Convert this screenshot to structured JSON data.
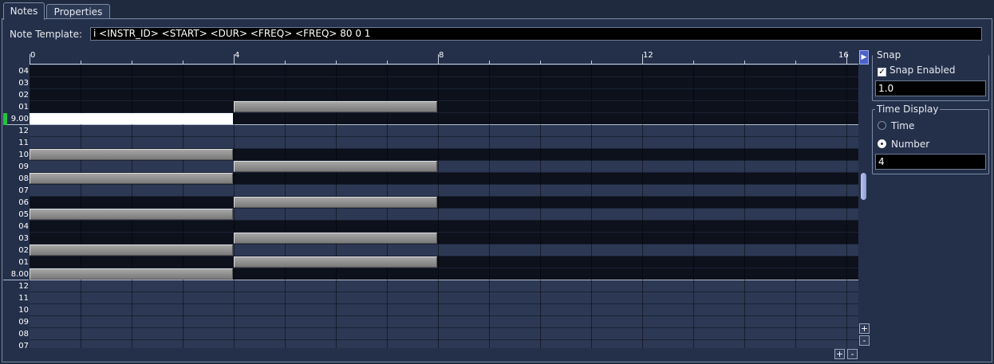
{
  "tabs": [
    {
      "label": "Notes",
      "active": true
    },
    {
      "label": "Properties",
      "active": false
    }
  ],
  "template": {
    "label": "Note Template:",
    "value": "i <INSTR_ID> <START> <DUR> <FREQ> <FREQ> 80 0 1"
  },
  "ruler": {
    "labels": [
      "0",
      "4",
      "8",
      "12",
      "16"
    ]
  },
  "rows": [
    {
      "label": "04",
      "shade": "dark",
      "octave": false
    },
    {
      "label": "03",
      "shade": "dark",
      "octave": false
    },
    {
      "label": "02",
      "shade": "dark",
      "octave": false
    },
    {
      "label": "01",
      "shade": "dark",
      "octave": false
    },
    {
      "label": "9.00",
      "shade": "dark",
      "octave": true
    },
    {
      "label": "12",
      "shade": "light",
      "octave": false
    },
    {
      "label": "11",
      "shade": "light",
      "octave": false
    },
    {
      "label": "10",
      "shade": "dark",
      "octave": false
    },
    {
      "label": "09",
      "shade": "light",
      "octave": false
    },
    {
      "label": "08",
      "shade": "dark",
      "octave": false
    },
    {
      "label": "07",
      "shade": "light",
      "octave": false
    },
    {
      "label": "06",
      "shade": "dark",
      "octave": false
    },
    {
      "label": "05",
      "shade": "light",
      "octave": false
    },
    {
      "label": "04",
      "shade": "dark",
      "octave": false
    },
    {
      "label": "03",
      "shade": "dark",
      "octave": false
    },
    {
      "label": "02",
      "shade": "light",
      "octave": false
    },
    {
      "label": "01",
      "shade": "dark",
      "octave": false
    },
    {
      "label": "8.00",
      "shade": "dark",
      "octave": true
    },
    {
      "label": "12",
      "shade": "light",
      "octave": false
    },
    {
      "label": "11",
      "shade": "light",
      "octave": false
    },
    {
      "label": "10",
      "shade": "light",
      "octave": false
    },
    {
      "label": "09",
      "shade": "light",
      "octave": false
    },
    {
      "label": "08",
      "shade": "light",
      "octave": false
    },
    {
      "label": "07",
      "shade": "light",
      "octave": false
    }
  ],
  "notes": [
    {
      "row": 3,
      "start": 4,
      "dur": 4,
      "selected": false
    },
    {
      "row": 4,
      "start": 0,
      "dur": 4,
      "selected": true
    },
    {
      "row": 7,
      "start": 0,
      "dur": 4,
      "selected": false
    },
    {
      "row": 8,
      "start": 4,
      "dur": 4,
      "selected": false
    },
    {
      "row": 9,
      "start": 0,
      "dur": 4,
      "selected": false
    },
    {
      "row": 11,
      "start": 4,
      "dur": 4,
      "selected": false
    },
    {
      "row": 12,
      "start": 0,
      "dur": 4,
      "selected": false
    },
    {
      "row": 14,
      "start": 4,
      "dur": 4,
      "selected": false
    },
    {
      "row": 15,
      "start": 0,
      "dur": 4,
      "selected": false
    },
    {
      "row": 16,
      "start": 4,
      "dur": 4,
      "selected": false
    },
    {
      "row": 17,
      "start": 0,
      "dur": 4,
      "selected": false
    }
  ],
  "snap": {
    "title": "Snap",
    "enabled_label": "Snap Enabled",
    "enabled": true,
    "value": "1.0"
  },
  "time_display": {
    "title": "Time Display",
    "options": [
      {
        "label": "Time",
        "selected": false
      },
      {
        "label": "Number",
        "selected": true
      }
    ],
    "value": "4"
  },
  "zoom": {
    "plus": "+",
    "minus": "-"
  },
  "colors": {
    "selected_marker": "#21c43a",
    "note_fill": "#8c8c8c"
  }
}
